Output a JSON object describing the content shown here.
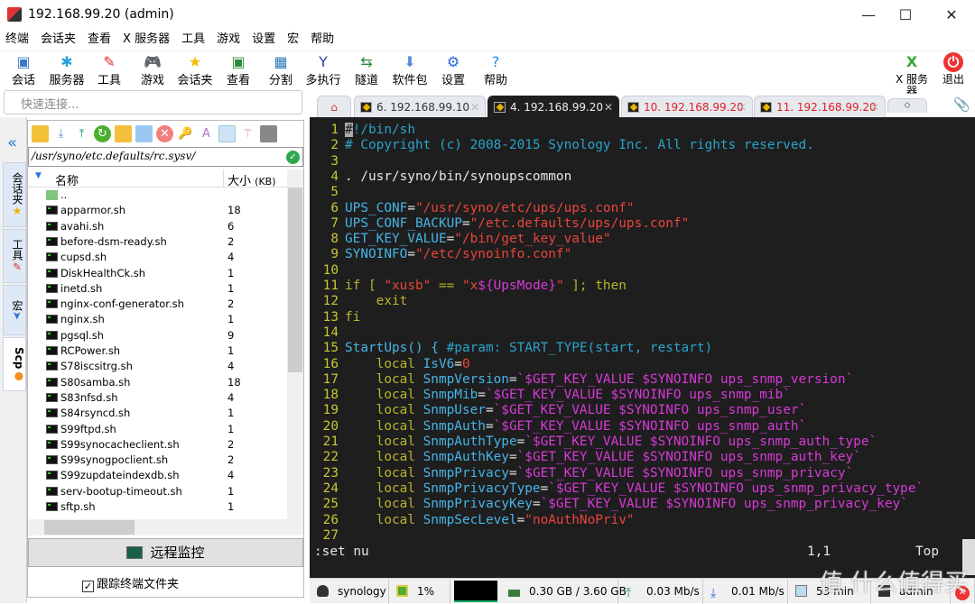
{
  "window": {
    "title": "192.168.99.20 (admin)",
    "minimize": "—",
    "maximize": "☐",
    "close": "✕"
  },
  "menu": [
    "终端",
    "会话夹",
    "查看",
    "X 服务器",
    "工具",
    "游戏",
    "设置",
    "宏",
    "帮助"
  ],
  "toolbar": [
    {
      "label": "会话",
      "icon": "session-icon",
      "glyph": "▣",
      "color": "#3a78c8"
    },
    {
      "label": "服务器",
      "icon": "servers-icon",
      "glyph": "✱",
      "color": "#2aa0d8"
    },
    {
      "label": "工具",
      "icon": "tools-icon",
      "glyph": "✎",
      "color": "#d33"
    },
    {
      "label": "游戏",
      "icon": "games-icon",
      "glyph": "🎮",
      "color": "#888"
    },
    {
      "label": "会话夹",
      "icon": "star-icon",
      "glyph": "★",
      "color": "#f0c000"
    },
    {
      "label": "查看",
      "icon": "view-icon",
      "glyph": "▣",
      "color": "#2a8a3a"
    },
    {
      "label": "分割",
      "icon": "split-icon",
      "glyph": "▦",
      "color": "#2a7ab8"
    },
    {
      "label": "多执行",
      "icon": "multiexec-icon",
      "glyph": "Y",
      "color": "#2a4aa8"
    },
    {
      "label": "隧道",
      "icon": "tunnel-icon",
      "glyph": "⇆",
      "color": "#2a8a3a"
    },
    {
      "label": "软件包",
      "icon": "packages-icon",
      "glyph": "⬇",
      "color": "#5a8ad8"
    },
    {
      "label": "设置",
      "icon": "settings-icon",
      "glyph": "⚙",
      "color": "#2a6ad8"
    },
    {
      "label": "帮助",
      "icon": "help-icon",
      "glyph": "?",
      "color": "#1a8ae8"
    }
  ],
  "toolbar_right": [
    {
      "label": "X 服务器",
      "icon": "x-server-icon",
      "glyph": "X"
    },
    {
      "label": "退出",
      "icon": "exit-icon",
      "glyph": "⏻"
    }
  ],
  "quick_connect": {
    "placeholder": "快速连接..."
  },
  "tabs": [
    {
      "label": "6. 192.168.99.10",
      "state": "normal"
    },
    {
      "label": "4. 192.168.99.20",
      "state": "active"
    },
    {
      "label": "10. 192.168.99.20",
      "state": "disconnected"
    },
    {
      "label": "11. 192.168.99.20",
      "state": "disconnected"
    }
  ],
  "sidebar_tabs": [
    "会话夹",
    "工具",
    "宏",
    "Scp"
  ],
  "file_panel": {
    "path": "/usr/syno/etc.defaults/rc.sysv/",
    "col_name": "名称",
    "col_size": "大小",
    "col_size_unit": "(KB)",
    "parent": "..",
    "files": [
      {
        "name": "apparmor.sh",
        "size": "18"
      },
      {
        "name": "avahi.sh",
        "size": "6"
      },
      {
        "name": "before-dsm-ready.sh",
        "size": "2"
      },
      {
        "name": "cupsd.sh",
        "size": "4"
      },
      {
        "name": "DiskHealthCk.sh",
        "size": "1"
      },
      {
        "name": "inetd.sh",
        "size": "1"
      },
      {
        "name": "nginx-conf-generator.sh",
        "size": "2"
      },
      {
        "name": "nginx.sh",
        "size": "1"
      },
      {
        "name": "pgsql.sh",
        "size": "9"
      },
      {
        "name": "RCPower.sh",
        "size": "1"
      },
      {
        "name": "S78iscsitrg.sh",
        "size": "4"
      },
      {
        "name": "S80samba.sh",
        "size": "18"
      },
      {
        "name": "S83nfsd.sh",
        "size": "4"
      },
      {
        "name": "S84rsyncd.sh",
        "size": "1"
      },
      {
        "name": "S99ftpd.sh",
        "size": "1"
      },
      {
        "name": "S99synocacheclient.sh",
        "size": "2"
      },
      {
        "name": "S99synogpoclient.sh",
        "size": "2"
      },
      {
        "name": "S99zupdateindexdb.sh",
        "size": "4"
      },
      {
        "name": "serv-bootup-timeout.sh",
        "size": "1"
      },
      {
        "name": "sftp.sh",
        "size": "1"
      }
    ],
    "remote_monitor": "远程监控",
    "follow_terminal": "跟踪终端文件夹",
    "follow_checked": true
  },
  "terminal": {
    "lines": [
      [
        [
          "#",
          "cursor"
        ],
        [
          "!/bin/sh",
          "cmt"
        ]
      ],
      [
        [
          "# Copyright (c) 2008-2015 Synology Inc. All rights reserved.",
          "cmt"
        ]
      ],
      [],
      [
        [
          ". /usr/syno/bin/synoupscommon",
          "norm"
        ]
      ],
      [],
      [
        [
          "UPS_CONF",
          "var"
        ],
        [
          "=",
          "norm"
        ],
        [
          "\"/usr/syno/etc/ups/ups.conf\"",
          "str"
        ]
      ],
      [
        [
          "UPS_CONF_BACKUP",
          "var"
        ],
        [
          "=",
          "norm"
        ],
        [
          "\"/etc.defaults/ups/ups.conf\"",
          "str"
        ]
      ],
      [
        [
          "GET_KEY_VALUE",
          "var"
        ],
        [
          "=",
          "norm"
        ],
        [
          "\"/bin/get_key_value\"",
          "str"
        ]
      ],
      [
        [
          "SYNOINFO",
          "var"
        ],
        [
          "=",
          "norm"
        ],
        [
          "\"/etc/synoinfo.conf\"",
          "str"
        ]
      ],
      [],
      [
        [
          "if [ ",
          "kw"
        ],
        [
          "\"xusb\"",
          "str"
        ],
        [
          " == ",
          "kw"
        ],
        [
          "\"x",
          "str"
        ],
        [
          "${UpsMode}",
          "cmd"
        ],
        [
          "\"",
          "str"
        ],
        [
          " ]; then",
          "kw"
        ]
      ],
      [
        [
          "    exit",
          "kw"
        ]
      ],
      [
        [
          "fi",
          "kw"
        ]
      ],
      [],
      [
        [
          "StartUps() { ",
          "var"
        ],
        [
          "#param: START_TYPE(start, restart)",
          "cmt"
        ]
      ],
      [
        [
          "    local ",
          "kw"
        ],
        [
          "IsV6",
          "var"
        ],
        [
          "=",
          "norm"
        ],
        [
          "0",
          "str"
        ]
      ],
      [
        [
          "    local ",
          "kw"
        ],
        [
          "SnmpVersion",
          "var"
        ],
        [
          "=",
          "norm"
        ],
        [
          "`$GET_KEY_VALUE $SYNOINFO ups_snmp_version`",
          "cmd"
        ]
      ],
      [
        [
          "    local ",
          "kw"
        ],
        [
          "SnmpMib",
          "var"
        ],
        [
          "=",
          "norm"
        ],
        [
          "`$GET_KEY_VALUE $SYNOINFO ups_snmp_mib`",
          "cmd"
        ]
      ],
      [
        [
          "    local ",
          "kw"
        ],
        [
          "SnmpUser",
          "var"
        ],
        [
          "=",
          "norm"
        ],
        [
          "`$GET_KEY_VALUE $SYNOINFO ups_snmp_user`",
          "cmd"
        ]
      ],
      [
        [
          "    local ",
          "kw"
        ],
        [
          "SnmpAuth",
          "var"
        ],
        [
          "=",
          "norm"
        ],
        [
          "`$GET_KEY_VALUE $SYNOINFO ups_snmp_auth`",
          "cmd"
        ]
      ],
      [
        [
          "    local ",
          "kw"
        ],
        [
          "SnmpAuthType",
          "var"
        ],
        [
          "=",
          "norm"
        ],
        [
          "`$GET_KEY_VALUE $SYNOINFO ups_snmp_auth_type`",
          "cmd"
        ]
      ],
      [
        [
          "    local ",
          "kw"
        ],
        [
          "SnmpAuthKey",
          "var"
        ],
        [
          "=",
          "norm"
        ],
        [
          "`$GET_KEY_VALUE $SYNOINFO ups_snmp_auth_key`",
          "cmd"
        ]
      ],
      [
        [
          "    local ",
          "kw"
        ],
        [
          "SnmpPrivacy",
          "var"
        ],
        [
          "=",
          "norm"
        ],
        [
          "`$GET_KEY_VALUE $SYNOINFO ups_snmp_privacy`",
          "cmd"
        ]
      ],
      [
        [
          "    local ",
          "kw"
        ],
        [
          "SnmpPrivacyType",
          "var"
        ],
        [
          "=",
          "norm"
        ],
        [
          "`$GET_KEY_VALUE $SYNOINFO ups_snmp_privacy_type`",
          "cmd"
        ]
      ],
      [
        [
          "    local ",
          "kw"
        ],
        [
          "SnmpPrivacyKey",
          "var"
        ],
        [
          "=",
          "norm"
        ],
        [
          "`$GET_KEY_VALUE $SYNOINFO ups_snmp_privacy_key`",
          "cmd"
        ]
      ],
      [
        [
          "    local ",
          "kw"
        ],
        [
          "SnmpSecLevel",
          "var"
        ],
        [
          "=",
          "norm"
        ],
        [
          "\"noAuthNoPriv\"",
          "str"
        ]
      ],
      []
    ],
    "command": ":set nu",
    "position": "1,1",
    "scroll": "Top"
  },
  "status": {
    "host": "synology",
    "cpu": "1%",
    "memory": "0.30 GB / 3.60 GB",
    "upload": "0.03 Mb/s",
    "download": "0.01 Mb/s",
    "uptime": "53 min",
    "user": "admin"
  },
  "watermark": "值 什么值得买"
}
